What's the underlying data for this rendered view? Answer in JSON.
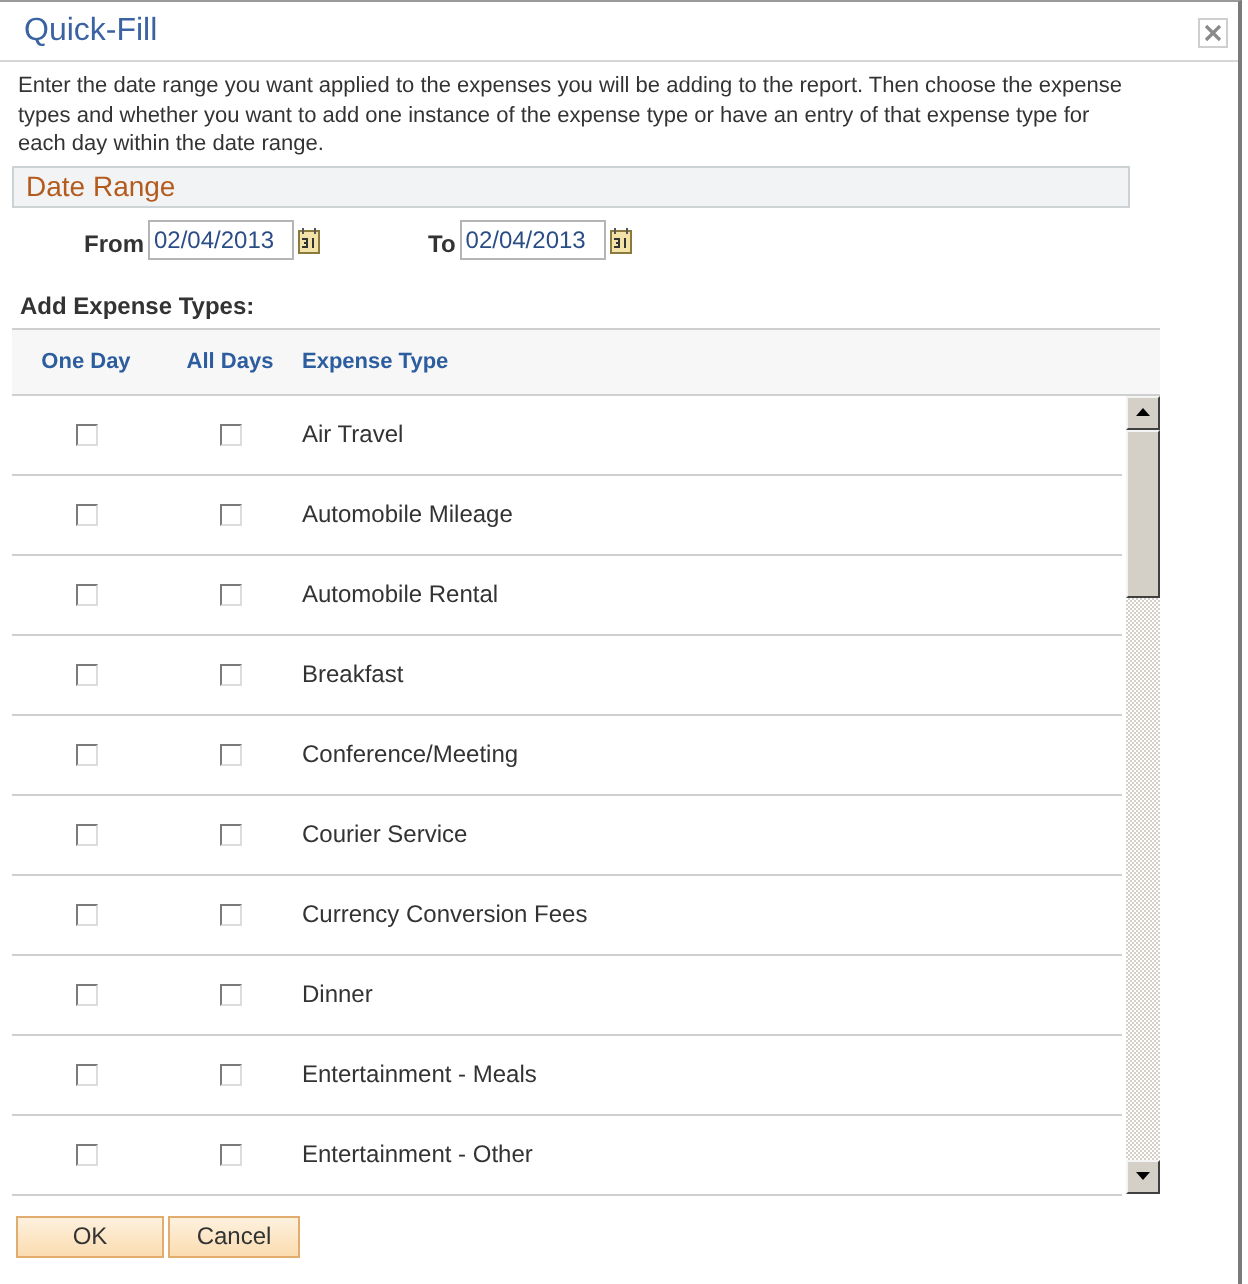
{
  "window": {
    "title": "Quick-Fill"
  },
  "instructions": "Enter the date range you want applied to the expenses you will be adding to the report. Then choose the expense types and whether you want to add one instance of the expense type or have an entry of that expense type for each day within the date range.",
  "date_range": {
    "title": "Date Range",
    "from": {
      "label": "From",
      "value": "02/04/2013"
    },
    "to": {
      "label": "To",
      "value": "02/04/2013"
    }
  },
  "expense_types": {
    "title": "Add Expense Types:",
    "columns": [
      "One Day",
      "All Days",
      "Expense Type"
    ],
    "rows": [
      {
        "name": "Air Travel",
        "one_day_checked": false,
        "all_days_checked": false
      },
      {
        "name": "Automobile Mileage",
        "one_day_checked": false,
        "all_days_checked": false
      },
      {
        "name": "Automobile Rental",
        "one_day_checked": false,
        "all_days_checked": false
      },
      {
        "name": "Breakfast",
        "one_day_checked": false,
        "all_days_checked": false
      },
      {
        "name": "Conference/Meeting",
        "one_day_checked": false,
        "all_days_checked": false
      },
      {
        "name": "Courier Service",
        "one_day_checked": false,
        "all_days_checked": false
      },
      {
        "name": "Currency Conversion Fees",
        "one_day_checked": false,
        "all_days_checked": false
      },
      {
        "name": "Dinner",
        "one_day_checked": false,
        "all_days_checked": false
      },
      {
        "name": "Entertainment - Meals",
        "one_day_checked": false,
        "all_days_checked": false
      },
      {
        "name": "Entertainment - Other",
        "one_day_checked": false,
        "all_days_checked": false
      }
    ]
  },
  "buttons": [
    {
      "label": "OK"
    },
    {
      "label": "Cancel"
    }
  ]
}
